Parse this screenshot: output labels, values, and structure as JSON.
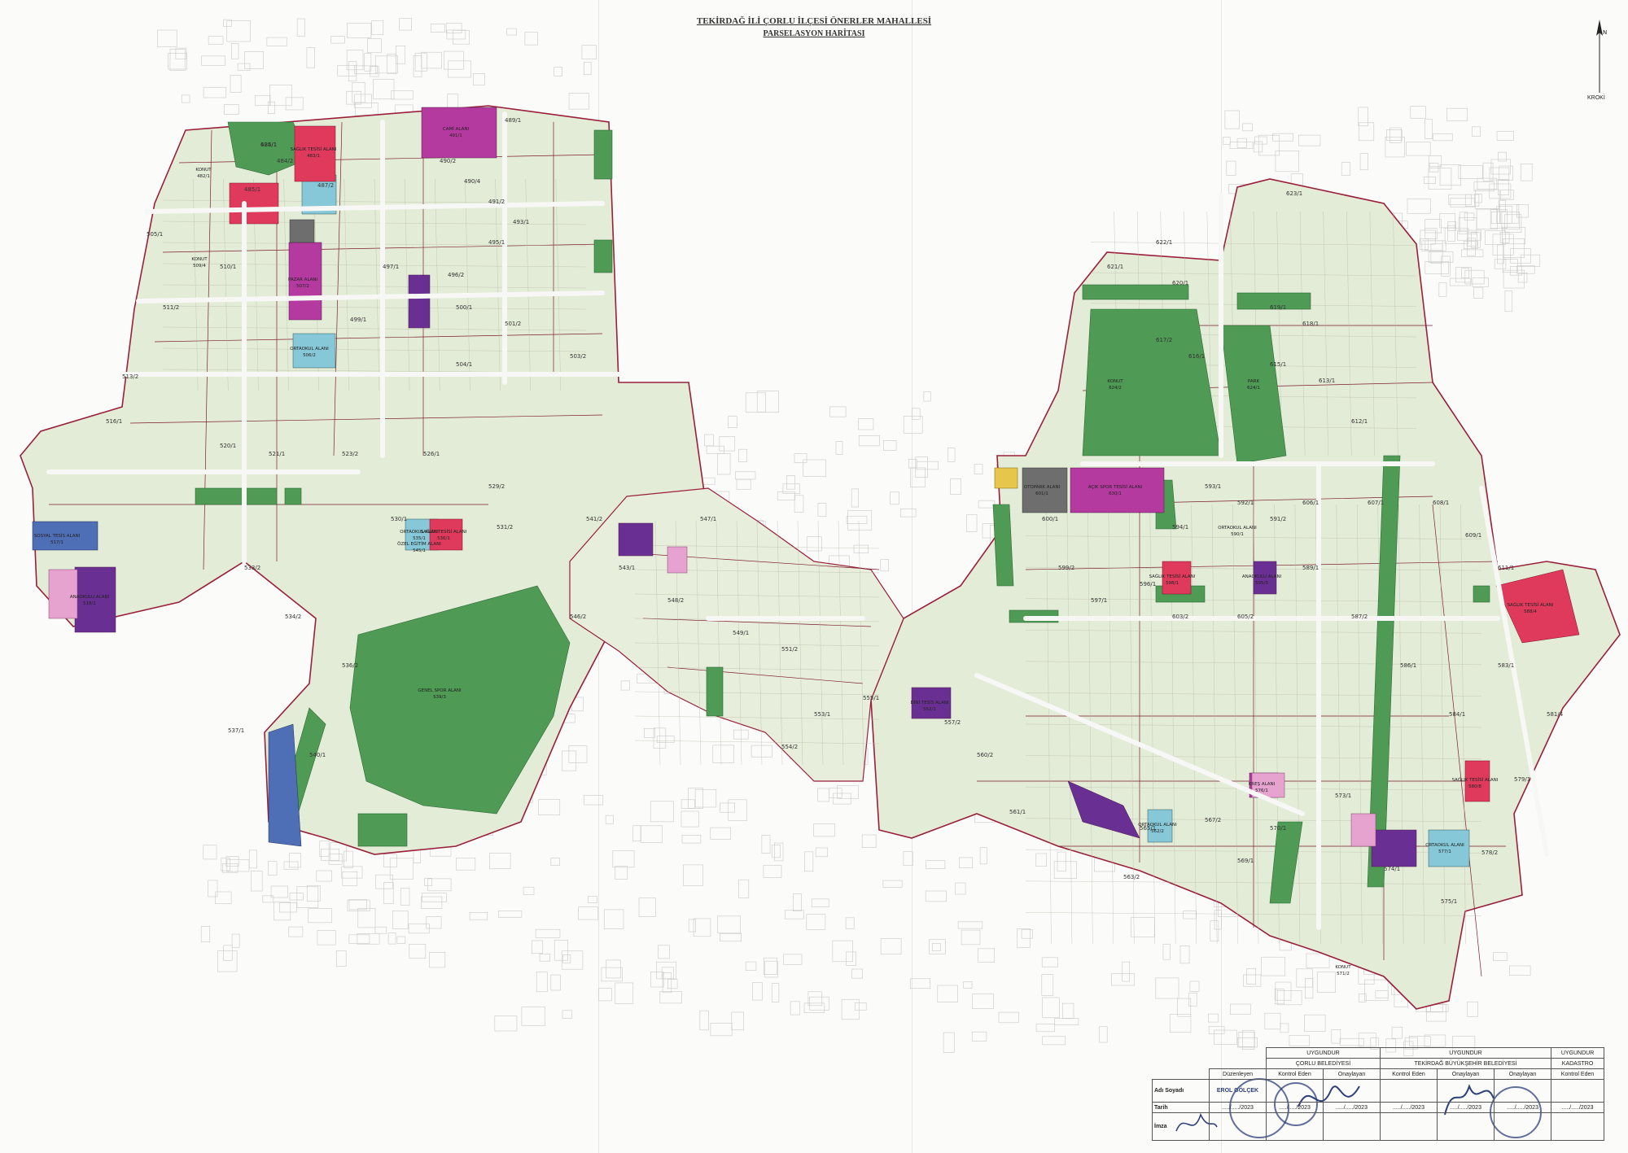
{
  "header": {
    "title": "TEKİRDAĞ İLİ ÇORLU İLÇESİ ÖNERLER MAHALLESİ",
    "subtitle": "PARSELASYON HARİTASI"
  },
  "north_arrow": {
    "label": "KROKİ"
  },
  "legend_colors": {
    "konut": "#e3ecd6",
    "park": "#4f9a55",
    "egitim": "#86c8d8",
    "dini_tesis": "#b43a9f",
    "saglik": "#df3a5c",
    "sosyal_tesis": "#4e6fb5",
    "sosyal_kultur": "#6a2f92",
    "ticaret": "#6e6e6e",
    "kres": "#e7a3cf",
    "kavsak": "#e6c64b",
    "boundary": "#9a1f3a"
  },
  "map": {
    "areas": [
      {
        "label": "KONUT",
        "parcel": "482/1"
      },
      {
        "label": "KONUT",
        "parcel": "509/4"
      },
      {
        "label": "CAMİ ALANI",
        "parcel": "491/1"
      },
      {
        "label": "SAĞLIK TESİSİ ALANI",
        "parcel": "483/1"
      },
      {
        "label": "ORTAOKUL ALANI",
        "parcel": "506/2"
      },
      {
        "label": "PAZAR ALANI",
        "parcel": "507/2"
      },
      {
        "label": "SOSYAL TESİS ALANI",
        "parcel": "517/1"
      },
      {
        "label": "ANAOKULU ALANI",
        "parcel": "518/1"
      },
      {
        "label": "ORTAOKUL ALANI",
        "parcel": "535/1"
      },
      {
        "label": "SAĞLIK TESİSİ ALANI",
        "parcel": "536/1"
      },
      {
        "label": "ÖZEL EĞİTİM ALANI",
        "parcel": "545/1"
      },
      {
        "label": "GENEL SPOR ALANI",
        "parcel": "539/3"
      },
      {
        "label": "KONUT",
        "parcel": "624/2"
      },
      {
        "label": "PARK",
        "parcel": "624/1"
      },
      {
        "label": "AÇIK SPOR TESİSİ ALANI",
        "parcel": "630/1"
      },
      {
        "label": "OTOPARK ALANI",
        "parcel": "601/1"
      },
      {
        "label": "SAĞLIK TESİSİ ALANI",
        "parcel": "598/1"
      },
      {
        "label": "ANAOKULU ALANI",
        "parcel": "595/3"
      },
      {
        "label": "ORTAOKUL ALANI",
        "parcel": "590/1"
      },
      {
        "label": "SAĞLIK TESİSİ ALANI",
        "parcel": "588/4"
      },
      {
        "label": "SAĞLIK TESİSİ ALANI",
        "parcel": "580/8"
      },
      {
        "label": "ORTAOKUL ALANI",
        "parcel": "577/1"
      },
      {
        "label": "ORTAOKUL ALANI",
        "parcel": "562/2"
      },
      {
        "label": "DİNİ TESİS ALANI",
        "parcel": "552/1"
      },
      {
        "label": "KREŞ ALANI",
        "parcel": "576/1"
      },
      {
        "label": "KONUT",
        "parcel": "571/2"
      }
    ],
    "parcels": [
      "484/1",
      "484/2",
      "485/1",
      "487/2",
      "489/1",
      "490/2",
      "490/4",
      "491/2",
      "493/1",
      "495/1",
      "496/2",
      "497/1",
      "499/1",
      "500/1",
      "501/2",
      "503/2",
      "504/1",
      "505/1",
      "510/1",
      "511/2",
      "513/2",
      "516/1",
      "520/1",
      "521/1",
      "523/2",
      "526/1",
      "529/2",
      "530/1",
      "531/2",
      "533/2",
      "534/2",
      "536/2",
      "537/1",
      "540/1",
      "541/2",
      "543/1",
      "546/2",
      "547/1",
      "548/2",
      "549/1",
      "551/2",
      "553/1",
      "554/2",
      "555/1",
      "557/2",
      "560/2",
      "561/1",
      "563/2",
      "565/1",
      "567/2",
      "569/1",
      "570/1",
      "573/1",
      "574/1",
      "575/1",
      "578/2",
      "579/1",
      "581/4",
      "583/1",
      "584/1",
      "586/1",
      "587/2",
      "589/1",
      "591/2",
      "592/1",
      "593/1",
      "594/1",
      "596/1",
      "597/1",
      "599/2",
      "600/1",
      "603/2",
      "605/2",
      "606/1",
      "607/1",
      "608/1",
      "609/1",
      "611/1",
      "612/1",
      "613/1",
      "615/1",
      "616/1",
      "617/2",
      "618/1",
      "619/1",
      "620/1",
      "621/1",
      "622/1",
      "623/1",
      "625/1"
    ]
  },
  "approval": {
    "headers": {
      "uygundur_corlu": "UYGUNDUR",
      "corlu": "ÇORLU BELEDİYESİ",
      "uygundur_tekirdag": "UYGUNDUR",
      "tekirdag": "TEKİRDAĞ BÜYÜKŞEHİR BELEDİYESİ",
      "uygundur_kadastro": "UYGUNDUR",
      "kadastro": "KADASTRO"
    },
    "roles": [
      "Düzenleyen",
      "Kontrol Eden",
      "Onaylayan",
      "Kontrol Eden",
      "Onaylayan",
      "Onaylayan",
      "Kontrol Eden"
    ],
    "row_labels": [
      "Adı Soyadı",
      "Tarih",
      "İmza"
    ],
    "name_value": "EROL GÖLÇEK",
    "dates": [
      "...../...../2023",
      "...../...../2023",
      "...../...../2023",
      "...../...../2023",
      "...../...../2023",
      "...../...../2023",
      "...../...../2023"
    ]
  }
}
